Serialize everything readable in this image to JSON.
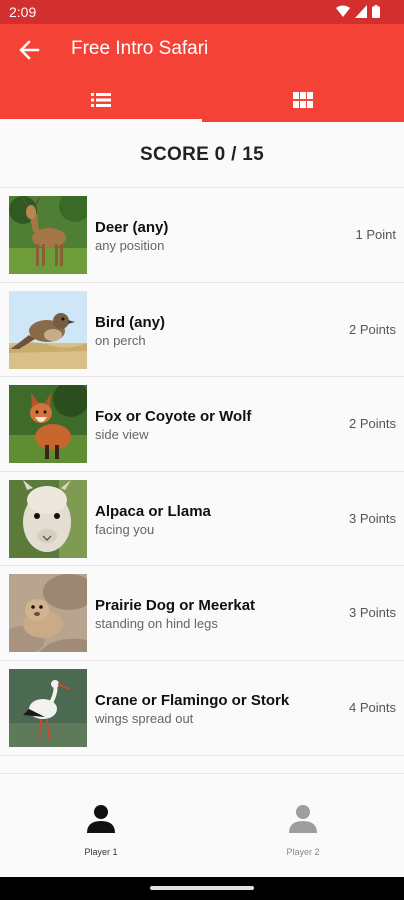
{
  "status_bar": {
    "time": "2:09"
  },
  "app_bar": {
    "title": "Free Intro Safari"
  },
  "tabs": [
    {
      "icon": "list-icon",
      "selected": true
    },
    {
      "icon": "grid-icon",
      "selected": false
    }
  ],
  "score": {
    "text": "SCORE 0 / 15"
  },
  "items": [
    {
      "name": "Deer (any)",
      "detail": "any position",
      "points": "1 Point",
      "image": "deer-photo"
    },
    {
      "name": "Bird (any)",
      "detail": "on perch",
      "points": "2 Points",
      "image": "bird-photo"
    },
    {
      "name": "Fox or Coyote or Wolf",
      "detail": "side view",
      "points": "2 Points",
      "image": "fox-photo"
    },
    {
      "name": "Alpaca or Llama",
      "detail": "facing you",
      "points": "3 Points",
      "image": "alpaca-photo"
    },
    {
      "name": "Prairie Dog or Meerkat",
      "detail": "standing on hind legs",
      "points": "3 Points",
      "image": "prairie-dog-photo"
    },
    {
      "name": "Crane or Flamingo or Stork",
      "detail": "wings spread out",
      "points": "4 Points",
      "image": "stork-photo"
    }
  ],
  "bottom_nav": [
    {
      "label": "Player 1",
      "selected": true
    },
    {
      "label": "Player 2",
      "selected": false
    }
  ],
  "colors": {
    "primary": "#f44336",
    "status_bar": "#d32f2f"
  }
}
